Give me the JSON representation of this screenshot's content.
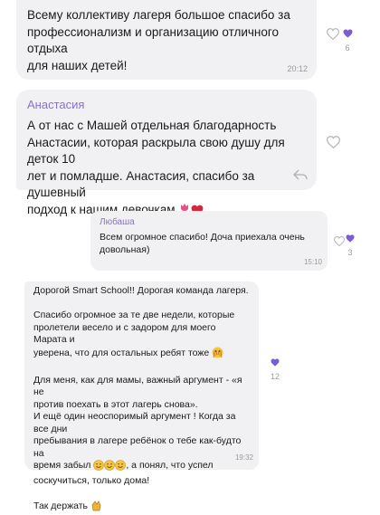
{
  "messages": [
    {
      "text": "Всему коллективу лагеря большое спасибо за\nпрофессионализм и организацию отличного отдыха\nдля наших детей!",
      "time": "20:12",
      "reaction_count": "6"
    },
    {
      "author": "Анастасия",
      "text": "А от нас с Машей отдельная благодарность\nАнастасии, которая раскрыла свою душу для деток 10\nлет и помладше. Анастасия, спасибо за душевный\nподход к нашим девочкам"
    },
    {
      "author": "Любаша",
      "text": "Всем огромное спасибо! Доча приехала очень\nдовольная)",
      "time": "15:10",
      "reaction_count": "3"
    },
    {
      "p1": "Дорогой Smart School!! Дорогая команда лагеря.",
      "p2": "Спасибо огромное за те две недели, которые\nпролетели  весело и с задором для моего Марата и\nуверена, что для остальных ребят тоже",
      "p3": "Для меня, как для мамы, важный аргумент - «я не\nпротив поехать в этот лагерь снова».\nИ ещё один неоспоримый аргумент ! Когда за все дни\nпребывания в лагере ребёнок о тебе  как-будто на\nвремя забыл",
      "p3b": " а понял, что успел\nсоскучиться, только дома!",
      "p4": "Так держать",
      "time": "19:32",
      "reaction_count": "12"
    }
  ],
  "colors": {
    "bubble": "#f1f1f3",
    "author": "#8b6fce",
    "heart": "#7c5cd6"
  },
  "icons": [
    "heart-outline-icon",
    "heart-filled-icon",
    "reply-arrow-icon",
    "tulip-emoji",
    "red-heart-emoji",
    "raised-hands-emoji",
    "smile-emoji",
    "clap-emoji"
  ]
}
